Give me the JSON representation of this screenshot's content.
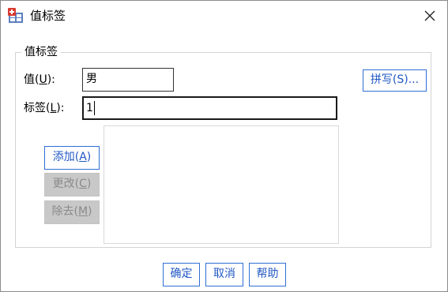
{
  "window": {
    "title": "值标签",
    "icon": "value-labels-app-icon",
    "close_icon": "close-icon"
  },
  "group": {
    "title": "值标签"
  },
  "value_field": {
    "label_text": "值(",
    "label_mnemonic": "U",
    "label_suffix": "):",
    "value": "男"
  },
  "label_field": {
    "label_text": "标签(",
    "label_mnemonic": "L",
    "label_suffix": "):",
    "value": "1"
  },
  "buttons": {
    "spelling": "拼写(S)...",
    "add": {
      "text": "添加(",
      "mnemonic": "A",
      "suffix": ")"
    },
    "change": {
      "text": "更改(",
      "mnemonic": "C",
      "suffix": ")"
    },
    "remove": {
      "text": "除去(",
      "mnemonic": "M",
      "suffix": ")"
    },
    "ok": "确定",
    "cancel": "取消",
    "help": "帮助"
  },
  "value_labels_list": [],
  "colors": {
    "accent": "#2f6fd6",
    "accent_text": "#2158c4",
    "disabled_bg": "#c8c8c8",
    "disabled_text": "#8a8a8a"
  }
}
